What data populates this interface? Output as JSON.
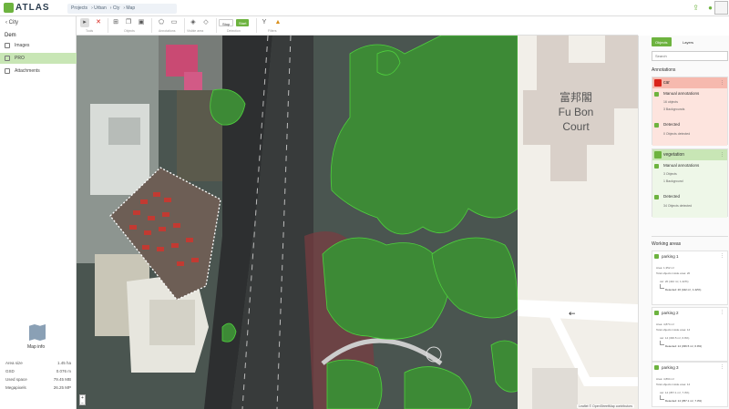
{
  "app": {
    "title": "ATLAS"
  },
  "breadcrumb": [
    "Projects",
    "Urban",
    "Cty",
    "Map"
  ],
  "sidebar": {
    "back": "City",
    "project": "Dem",
    "items": [
      {
        "label": "Images",
        "active": false
      },
      {
        "label": "PRO",
        "active": true
      },
      {
        "label": "Attachments",
        "active": false
      }
    ],
    "map_info": {
      "title": "Map info",
      "rows": [
        {
          "label": "Area size",
          "value": "1.45 ha"
        },
        {
          "label": "GSD",
          "value": "0.076 m"
        },
        {
          "label": "Used space",
          "value": "79.45 MB"
        },
        {
          "label": "Megapixels",
          "value": "26.25 MP"
        }
      ]
    }
  },
  "toolbar": {
    "groups": [
      "Tools",
      "Objects",
      "Annotations",
      "Visible area",
      "Detection",
      "Filters"
    ],
    "start_label": "Start",
    "stop_label": "Stop"
  },
  "map": {
    "label_cn": "富邦閣",
    "label_en1": "Fu Bon",
    "label_en2": "Court",
    "attribution": "Leaflet © OpenStreetMap contributors"
  },
  "right_panel": {
    "tabs": [
      "Objects",
      "Layers"
    ],
    "search_placeholder": "Search",
    "annotations_title": "Annotations",
    "cards": [
      {
        "name": "car",
        "color": "#d9241b",
        "bg": "#f6b9ae",
        "manual_label": "Manual annotations",
        "objects": "16 objects",
        "background": "3 Backgrounds",
        "detected_label": "Detected",
        "detected_count": "0 Objects detected"
      },
      {
        "name": "vegetation",
        "color": "#6db33f",
        "bg": "#c8e6b5",
        "manual_label": "Manual annotations",
        "objects": "3 Objects",
        "background": "1 Background",
        "detected_label": "Detected",
        "detected_count": "34 Objects detected"
      }
    ],
    "working_areas_title": "Working areas",
    "working_areas": [
      {
        "name": "parking 1",
        "area": "Area: 1,352 m²",
        "total": "Total objects inside area: 20",
        "class": "car: 20 (442 m², 1.42%)",
        "detected": "Detected: 20 (442 m², 1.42%)"
      },
      {
        "name": "parking 2",
        "area": "Area: 4,874 m²",
        "total": "Total objects inside area: 14",
        "class": "car: 14 (336.5 m², 6.9%)",
        "detected": "Detected: 14 (336.5 m², 6.9%)"
      },
      {
        "name": "parking 3",
        "area": "Area: 4,894 m²",
        "total": "Total objects inside area: 14",
        "class": "car: 14 (357.1 m², 7.3%)",
        "detected": "Detected: 14 (357.1 m², 7.3%)"
      }
    ]
  }
}
